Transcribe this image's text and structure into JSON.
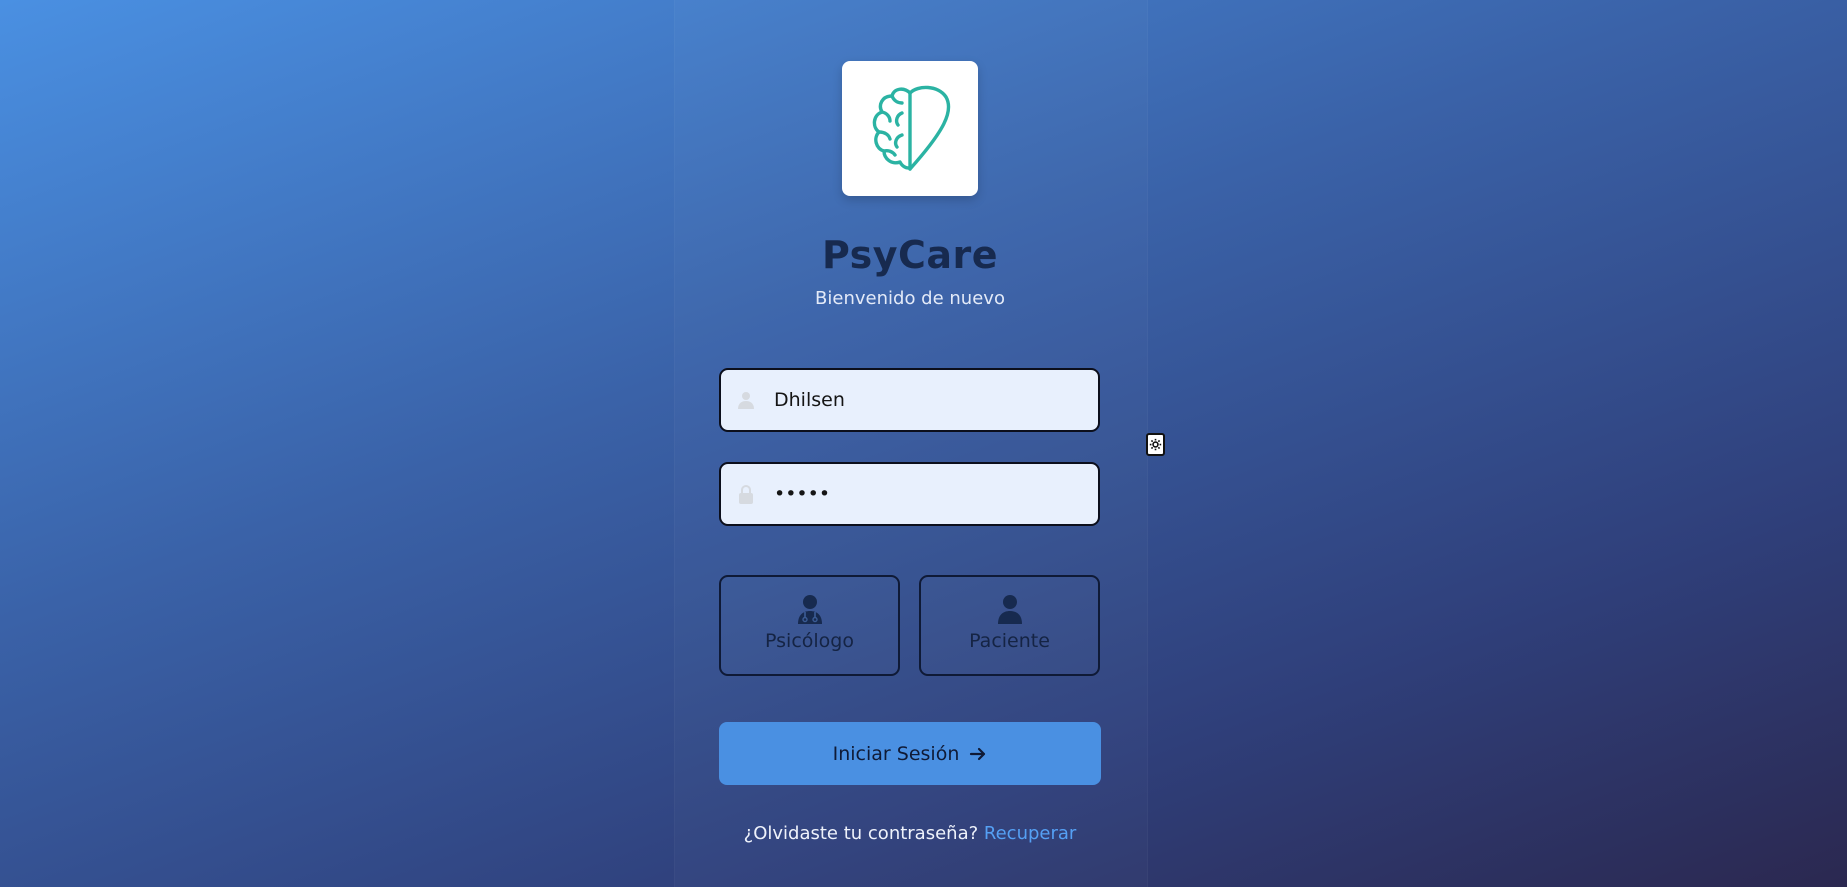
{
  "app": {
    "title": "PsyCare",
    "subtitle": "Bienvenido de nuevo",
    "logo_icon": "brain-heart-icon"
  },
  "form": {
    "username_value": "Dhilsen",
    "username_icon": "user-icon",
    "password_value": "•••••",
    "password_icon": "lock-icon"
  },
  "roles": [
    {
      "label": "Psicólogo",
      "icon": "doctor-icon"
    },
    {
      "label": "Paciente",
      "icon": "user-icon"
    }
  ],
  "login_button": {
    "label": "Iniciar Sesión",
    "icon": "arrow-right-icon"
  },
  "recovery": {
    "prompt": "¿Olvidaste tu contraseña?",
    "link": "Recuperar"
  },
  "colors": {
    "accent": "#4a90e2",
    "logo_teal": "#2bb3a3",
    "title": "#172a4f"
  }
}
